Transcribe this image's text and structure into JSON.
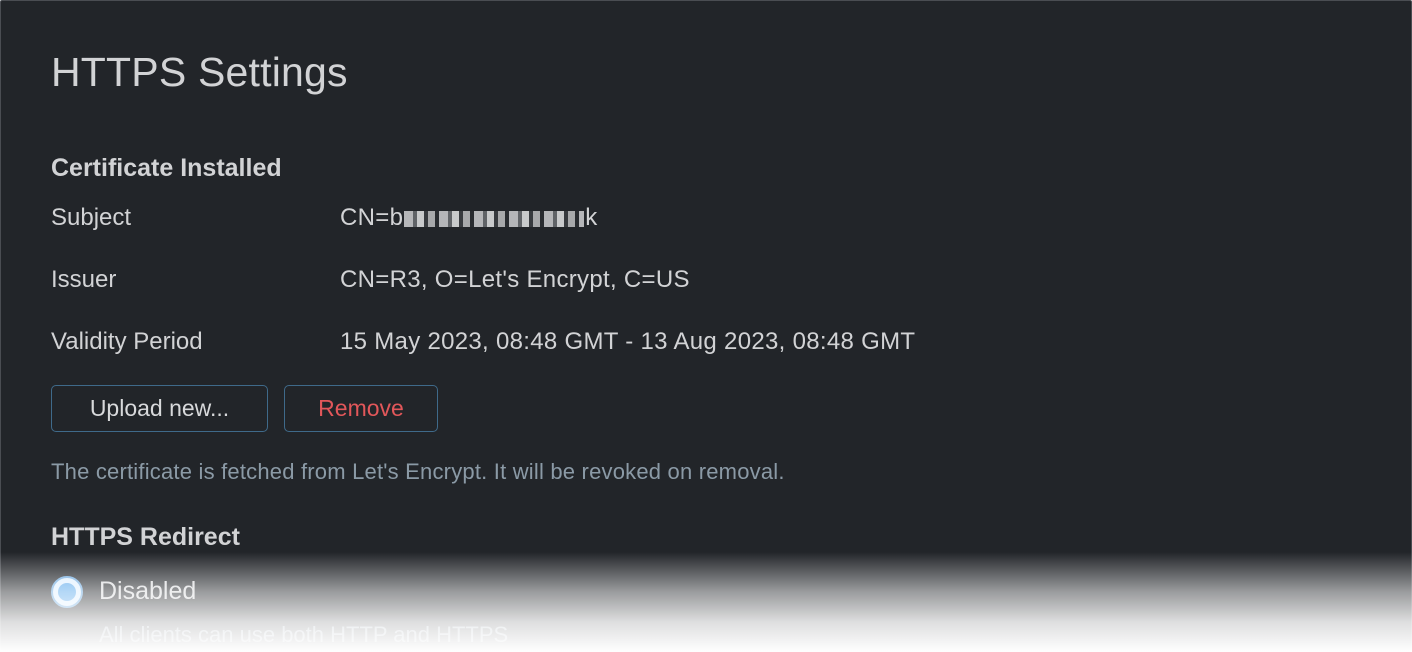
{
  "page": {
    "title": "HTTPS Settings"
  },
  "certificate": {
    "heading": "Certificate Installed",
    "rows": [
      {
        "label": "Subject",
        "value_prefix": "CN=b",
        "value_suffix": "k",
        "redacted": true
      },
      {
        "label": "Issuer",
        "value": "CN=R3, O=Let's Encrypt, C=US"
      },
      {
        "label": "Validity Period",
        "value": "15 May 2023, 08:48 GMT - 13 Aug 2023, 08:48 GMT"
      }
    ],
    "buttons": {
      "upload_label": "Upload new...",
      "remove_label": "Remove"
    },
    "note": "The certificate is fetched from Let's Encrypt. It will be revoked on removal."
  },
  "redirect": {
    "heading": "HTTPS Redirect",
    "options": [
      {
        "label": "Disabled",
        "description": "All clients can use both HTTP and HTTPS",
        "selected": true
      }
    ]
  },
  "colors": {
    "background": "#222529",
    "button_border": "#3f6a8a",
    "danger": "#e2575a",
    "note_text": "#8b9aa6",
    "radio_accent": "#5aa9ec"
  }
}
